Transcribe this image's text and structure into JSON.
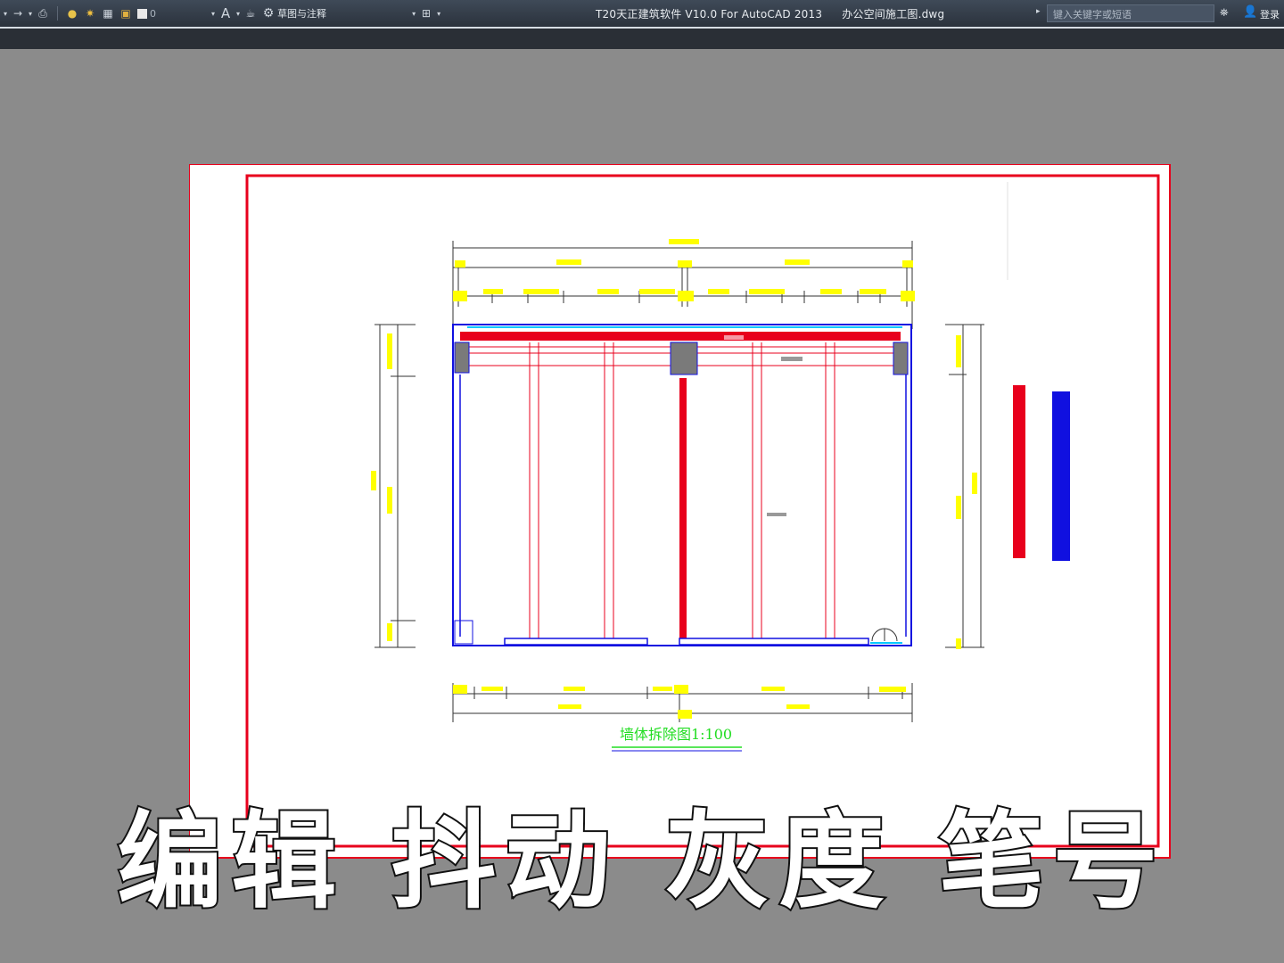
{
  "titlebar": {
    "app_title": "T20天正建筑软件 V10.0 For AutoCAD 2013",
    "file_name": "办公空间施工图.dwg",
    "layer_value": "0",
    "workspace": "草图与注释",
    "search_placeholder": "键入关键字或短语",
    "login_label": "登录"
  },
  "drawing": {
    "title": "墙体拆除图1:100",
    "colors": {
      "frame": "#e8001c",
      "wall_demolish": "#e8001c",
      "wall_new": "#1010e0",
      "dimension": "#ffff00",
      "title": "#22dd22",
      "cyan": "#00c8ff"
    }
  },
  "caption": "编辑 抖动 灰度 笔号"
}
